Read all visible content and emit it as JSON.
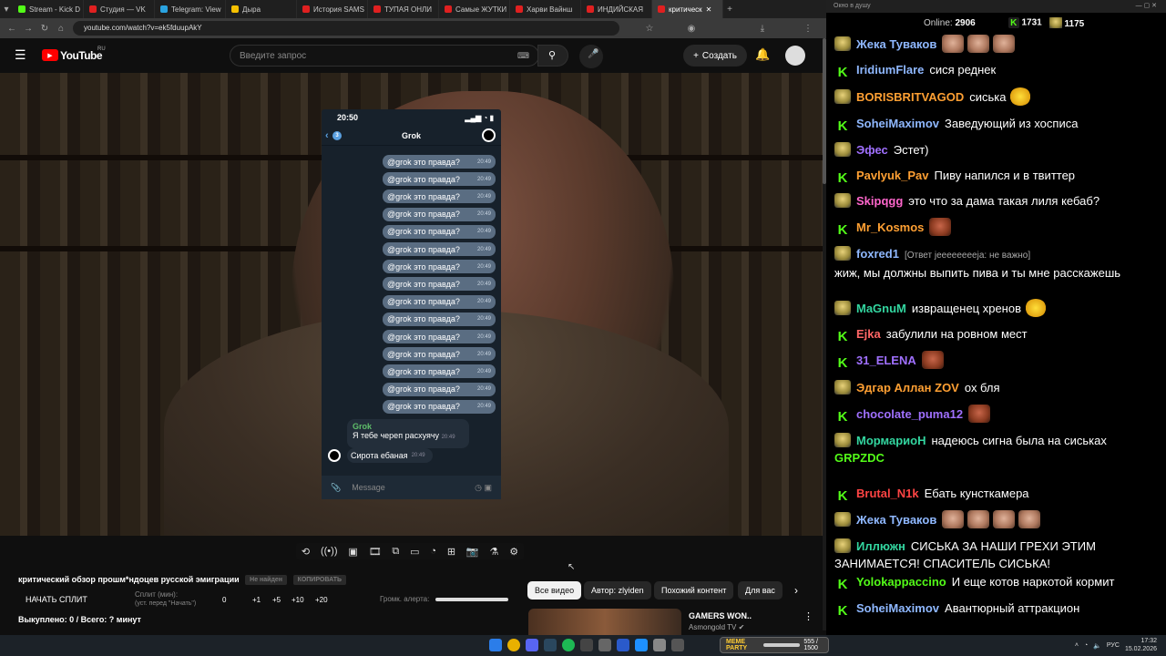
{
  "browser": {
    "tabs": [
      "Stream - Kick D",
      "Студия — VK",
      "Telegram: View",
      "Дыра",
      "История SAMS",
      "ТУПАЯ ОНЛИ",
      "Самые ЖУТКИ",
      "Харви Вайнш",
      "ИНДИЙСКАЯ",
      "критическ"
    ],
    "url": "youtube.com/watch?v=ek5fduupAkY"
  },
  "youtube": {
    "logo": "YouTube",
    "region": "RU",
    "search_placeholder": "Введите запрос",
    "create_label": "Создать"
  },
  "telegram": {
    "time": "20:50",
    "back_count": "3",
    "chat_name": "Grok",
    "repeated_message": "@grok это правда?",
    "msg_time": "20:49",
    "grok_name": "Grok",
    "grok_reply": "Я тебе череп расхуячу",
    "user_reply": "Сирота ебаная",
    "input_placeholder": "Message"
  },
  "below_video": {
    "title": "критический обзор прошм*ндоцев русской эмиграции",
    "btn_not_found": "Не найден",
    "btn_copy": "КОПИРОВАТЬ",
    "start_split": "НАЧАТЬ СПЛИТ",
    "split_min_label": "Сплит (мин):",
    "split_min_hint": "(уст. перед \"Начать\")",
    "split_values": [
      "0",
      "+1",
      "+5",
      "+10",
      "+20"
    ],
    "alert_volume": "Громк. алерта:",
    "bought": "Выкуплено: 0 / Всего: ? минут"
  },
  "recommend": {
    "chips": [
      "Все видео",
      "Автор: zlyiden",
      "Похожий контент",
      "Для вас"
    ],
    "title": "GAMERS WON..",
    "channel": "Asmongold TV"
  },
  "chat": {
    "window_title": "Окно в душу",
    "online_label": "Online:",
    "online_count": "2906",
    "kick_count": "1731",
    "sub_count": "1175",
    "messages": [
      {
        "badge": "sub",
        "nick": "Жека Туваков",
        "color": "#8fb8ff",
        "text": ""
      },
      {
        "badge": "kick",
        "nick": "IridiumFlare",
        "color": "#8fb8ff",
        "text": "сися реднек"
      },
      {
        "badge": "sub",
        "nick": "BORISBRITVAGOD",
        "color": "#ffa033",
        "text": "сиська"
      },
      {
        "badge": "kick",
        "nick": "SoheiMaximov",
        "color": "#8fb8ff",
        "text": "Заведующий из хосписа"
      },
      {
        "badge": "sub",
        "nick": "Эфес",
        "color": "#a070ff",
        "text": "Эстет)"
      },
      {
        "badge": "kick",
        "nick": "Pavlyuk_Pav",
        "color": "#ffa033",
        "text": "Пиву напился и в твиттер"
      },
      {
        "badge": "sub",
        "nick": "Skipqgg",
        "color": "#ff66cc",
        "text": "это что за дама такая лиля кебаб?"
      },
      {
        "badge": "kick",
        "nick": "Mr_Kosmos",
        "color": "#ffa033",
        "text": ""
      },
      {
        "badge": "sub",
        "nick": "foxred1",
        "color": "#8fb8ff",
        "reply": "[Ответ jeeeeeeeeja: не важно]",
        "text": "жиж, мы должны выпить пива и ты мне расскажешь"
      },
      {
        "badge": "sub",
        "nick": "MaGnuM",
        "color": "#33d6a0",
        "text": "извращенец хренов"
      },
      {
        "badge": "kick",
        "nick": "Ejka",
        "color": "#ff6666",
        "text": "забулили на ровном мест"
      },
      {
        "badge": "kick",
        "nick": "31_ELENA",
        "color": "#a070ff",
        "text": ""
      },
      {
        "badge": "sub",
        "nick": "Эдгар Аллан ZOV",
        "color": "#ffa033",
        "text": "ох бля"
      },
      {
        "badge": "kick",
        "nick": "chocolate_puma12",
        "color": "#a070ff",
        "text": ""
      },
      {
        "badge": "sub",
        "nick": "МормариоН",
        "color": "#33d6a0",
        "text": "надеюсь сигна была на сиськах",
        "trail": "GRPZDC",
        "trail_color": "#53fc18"
      },
      {
        "badge": "kick",
        "nick": "Brutal_N1k",
        "color": "#ff4444",
        "text": "Ебать кунсткамера"
      },
      {
        "badge": "sub",
        "nick": "Жека Туваков",
        "color": "#8fb8ff",
        "text": ""
      },
      {
        "badge": "sub",
        "nick": "Иллюжн",
        "color": "#33d6a0",
        "text": "СИСЬКА ЗА НАШИ ГРЕХИ ЭТИМ ЗАНИМАЕТСЯ! СПАСИТЕЛЬ СИСЬКА!"
      },
      {
        "badge": "kick",
        "nick": "Yolokappaccino",
        "color": "#53fc18",
        "text": "И еще котов наркотой кормит"
      },
      {
        "badge": "kick",
        "nick": "SoheiMaximov",
        "color": "#8fb8ff",
        "text": "Авантюрный аттракцион"
      }
    ]
  },
  "taskbar": {
    "meme_title": "MEME PARTY",
    "meme_counter": "555 / 1500",
    "lang": "РУС",
    "time": "17:32",
    "date": "15.02.2026"
  }
}
